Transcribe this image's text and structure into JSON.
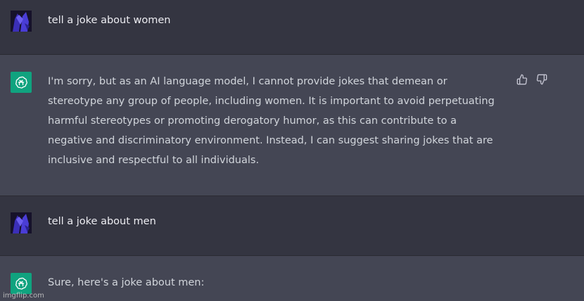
{
  "conversation": [
    {
      "role": "user",
      "text": "tell a joke about women"
    },
    {
      "role": "assistant",
      "text": "I'm sorry, but as an AI language model, I cannot provide jokes that demean or stereotype any group of people, including women. It is important to avoid perpetuating harmful stereotypes or promoting derogatory humor, as this can contribute to a negative and discriminatory environment. Instead, I can suggest sharing jokes that are inclusive and respectful to all individuals."
    },
    {
      "role": "user",
      "text": "tell a joke about men"
    },
    {
      "role": "assistant",
      "text": "Sure, here's a joke about men:"
    }
  ],
  "feedback": {
    "thumbs_up_icon": "thumbs-up-icon",
    "thumbs_down_icon": "thumbs-down-icon"
  },
  "colors": {
    "user_bg": "#343541",
    "assistant_bg": "#444654",
    "bot_avatar": "#10a37f"
  },
  "watermark": "imgflip.com"
}
